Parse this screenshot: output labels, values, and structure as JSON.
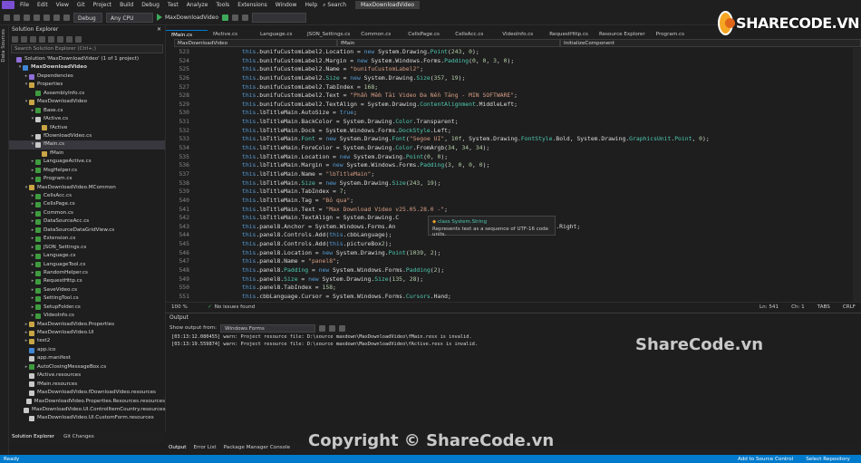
{
  "menubar": {
    "items": [
      "File",
      "Edit",
      "View",
      "Git",
      "Project",
      "Build",
      "Debug",
      "Test",
      "Analyze",
      "Tools",
      "Extensions",
      "Window",
      "Help"
    ],
    "search": "Search",
    "window_title": "MaxDownloadVideo"
  },
  "toolbar": {
    "config": "Debug",
    "platform": "Any CPU",
    "run_target": "MaxDownloadVideo"
  },
  "left_strip": {
    "label": "Data Sources"
  },
  "solution_explorer": {
    "title": "Solution Explorer",
    "search_placeholder": "Search Solution Explorer (Ctrl+;)",
    "items": [
      {
        "label": "Solution 'MaxDownloadVideo' (1 of 1 project)",
        "indent": 0,
        "toggle": "",
        "color": "#8f6fd8"
      },
      {
        "label": "MaxDownloadVideo",
        "indent": 1,
        "toggle": "▾",
        "color": "#3f86d6",
        "bold": true
      },
      {
        "label": "Dependencies",
        "indent": 2,
        "toggle": "▸",
        "color": "#8f6fd8"
      },
      {
        "label": "Properties",
        "indent": 2,
        "toggle": "▾",
        "color": "#c9a545"
      },
      {
        "label": "AssemblyInfo.cs",
        "indent": 3,
        "toggle": "",
        "color": "#3f9b3f"
      },
      {
        "label": "MaxDownloadVideo",
        "indent": 2,
        "toggle": "▾",
        "color": "#c9a545"
      },
      {
        "label": "Base.cs",
        "indent": 3,
        "toggle": "▸",
        "color": "#3f9b3f"
      },
      {
        "label": "fActive.cs",
        "indent": 3,
        "toggle": "▾",
        "color": "#c9c9c9"
      },
      {
        "label": "fActive",
        "indent": 4,
        "toggle": "",
        "color": "#c9a545"
      },
      {
        "label": "fDownloadVideo.cs",
        "indent": 3,
        "toggle": "▸",
        "color": "#c9c9c9"
      },
      {
        "label": "fMain.cs",
        "indent": 3,
        "toggle": "▾",
        "color": "#c9c9c9",
        "selected": true
      },
      {
        "label": "fMain",
        "indent": 4,
        "toggle": "",
        "color": "#c9a545"
      },
      {
        "label": "LanguageActive.cs",
        "indent": 3,
        "toggle": "▸",
        "color": "#3f9b3f"
      },
      {
        "label": "MsgHelper.cs",
        "indent": 3,
        "toggle": "▸",
        "color": "#3f9b3f"
      },
      {
        "label": "Program.cs",
        "indent": 3,
        "toggle": "▸",
        "color": "#3f9b3f"
      },
      {
        "label": "MaxDownloadVideo.MCommon",
        "indent": 2,
        "toggle": "▾",
        "color": "#c9a545"
      },
      {
        "label": "CellsAcc.cs",
        "indent": 3,
        "toggle": "▸",
        "color": "#3f9b3f"
      },
      {
        "label": "CellsPage.cs",
        "indent": 3,
        "toggle": "▸",
        "color": "#3f9b3f"
      },
      {
        "label": "Common.cs",
        "indent": 3,
        "toggle": "▸",
        "color": "#3f9b3f"
      },
      {
        "label": "DataSourceAcc.cs",
        "indent": 3,
        "toggle": "▸",
        "color": "#3f9b3f"
      },
      {
        "label": "DataSourceDataGridView.cs",
        "indent": 3,
        "toggle": "▸",
        "color": "#3f9b3f"
      },
      {
        "label": "Extension.cs",
        "indent": 3,
        "toggle": "▸",
        "color": "#3f9b3f"
      },
      {
        "label": "JSON_Settings.cs",
        "indent": 3,
        "toggle": "▸",
        "color": "#3f9b3f"
      },
      {
        "label": "Language.cs",
        "indent": 3,
        "toggle": "▸",
        "color": "#3f9b3f"
      },
      {
        "label": "LanguageTool.cs",
        "indent": 3,
        "toggle": "▸",
        "color": "#3f9b3f"
      },
      {
        "label": "RandomHelper.cs",
        "indent": 3,
        "toggle": "▸",
        "color": "#3f9b3f"
      },
      {
        "label": "RequestHttp.cs",
        "indent": 3,
        "toggle": "▸",
        "color": "#3f9b3f"
      },
      {
        "label": "SaveVideo.cs",
        "indent": 3,
        "toggle": "▸",
        "color": "#3f9b3f"
      },
      {
        "label": "SettingTool.cs",
        "indent": 3,
        "toggle": "▸",
        "color": "#3f9b3f"
      },
      {
        "label": "SetupFolder.cs",
        "indent": 3,
        "toggle": "▸",
        "color": "#3f9b3f"
      },
      {
        "label": "VideoInfo.cs",
        "indent": 3,
        "toggle": "▸",
        "color": "#3f9b3f"
      },
      {
        "label": "MaxDownloadVideo.Properties",
        "indent": 2,
        "toggle": "▸",
        "color": "#c9a545"
      },
      {
        "label": "MaxDownloadVideo.UI",
        "indent": 2,
        "toggle": "▸",
        "color": "#c9a545"
      },
      {
        "label": "test2",
        "indent": 2,
        "toggle": "▸",
        "color": "#c9a545"
      },
      {
        "label": "app.ico",
        "indent": 2,
        "toggle": "",
        "color": "#3f86d6"
      },
      {
        "label": "app.manifest",
        "indent": 2,
        "toggle": "",
        "color": "#c9c9c9"
      },
      {
        "label": "AutoClosingMessageBox.cs",
        "indent": 2,
        "toggle": "▸",
        "color": "#3f9b3f"
      },
      {
        "label": "fActive.resources",
        "indent": 2,
        "toggle": "",
        "color": "#c9c9c9"
      },
      {
        "label": "fMain.resources",
        "indent": 2,
        "toggle": "",
        "color": "#c9c9c9"
      },
      {
        "label": "MaxDownloadVideo.fDownloadVideo.resources",
        "indent": 2,
        "toggle": "",
        "color": "#c9c9c9"
      },
      {
        "label": "MaxDownloadVideo.Properties.Resources.resources",
        "indent": 2,
        "toggle": "",
        "color": "#c9c9c9"
      },
      {
        "label": "MaxDownloadVideo.UI.ControlItemCountry.resources",
        "indent": 2,
        "toggle": "",
        "color": "#c9c9c9"
      },
      {
        "label": "MaxDownloadVideo.UI.CustomForm.resources",
        "indent": 2,
        "toggle": "",
        "color": "#c9c9c9"
      }
    ],
    "tabs": [
      "Solution Explorer",
      "Git Changes"
    ]
  },
  "doc_tabs": [
    "fMain.cs",
    "fActive.cs",
    "Language.cs",
    "JSON_Settings.cs",
    "Common.cs",
    "CellsPage.cs",
    "CellsAcc.cs",
    "VideoInfo.cs",
    "RequestHttp.cs",
    "Resource Explorer",
    "Program.cs"
  ],
  "navbar": {
    "project": "MaxDownloadVideo",
    "class": "fMain",
    "member": "InitializeComponent"
  },
  "code": [
    {
      "n": "523",
      "t": "this.bunifuCustomLabel2.Location = new System.Drawing.Point(243, 0);"
    },
    {
      "n": "524",
      "t": "this.bunifuCustomLabel2.Margin = new System.Windows.Forms.Padding(0, 0, 3, 0);"
    },
    {
      "n": "525",
      "t": "this.bunifuCustomLabel2.Name = \"bunifuCustomLabel2\";"
    },
    {
      "n": "526",
      "t": "this.bunifuCustomLabel2.Size = new System.Drawing.Size(357, 19);"
    },
    {
      "n": "527",
      "t": "this.bunifuCustomLabel2.TabIndex = 168;"
    },
    {
      "n": "528",
      "t": "this.bunifuCustomLabel2.Text = \"Phần Mềm Tải Video Đa Nền Tảng - MIN SOFTWARE\";"
    },
    {
      "n": "529",
      "t": "this.bunifuCustomLabel2.TextAlign = System.Drawing.ContentAlignment.MiddleLeft;"
    },
    {
      "n": "530",
      "t": "this.lbTitleMain.AutoSize = true;"
    },
    {
      "n": "531",
      "t": "this.lbTitleMain.BackColor = System.Drawing.Color.Transparent;"
    },
    {
      "n": "532",
      "t": "this.lbTitleMain.Dock = System.Windows.Forms.DockStyle.Left;"
    },
    {
      "n": "533",
      "t": "this.lbTitleMain.Font = new System.Drawing.Font(\"Segoe UI\", 10f, System.Drawing.FontStyle.Bold, System.Drawing.GraphicsUnit.Point, 0);"
    },
    {
      "n": "534",
      "t": "this.lbTitleMain.ForeColor = System.Drawing.Color.FromArgb(34, 34, 34);"
    },
    {
      "n": "535",
      "t": "this.lbTitleMain.Location = new System.Drawing.Point(0, 0);"
    },
    {
      "n": "536",
      "t": "this.lbTitleMain.Margin = new System.Windows.Forms.Padding(3, 0, 0, 0);"
    },
    {
      "n": "537",
      "t": "this.lbTitleMain.Name = \"lbTitleMain\";"
    },
    {
      "n": "538",
      "t": "this.lbTitleMain.Size = new System.Drawing.Size(243, 19);"
    },
    {
      "n": "539",
      "t": "this.lbTitleMain.TabIndex = 7;"
    },
    {
      "n": "540",
      "t": "this.lbTitleMain.Tag = \"Bỏ qua\";"
    },
    {
      "n": "541",
      "t": "this.lbTitleMain.Text = \"Max Download Video v25.05.28.0 -\";"
    },
    {
      "n": "542",
      "t": "this.lbTitleMain.TextAlign = System.Drawing.C"
    },
    {
      "n": "543",
      "t": "this.panel8.Anchor = System.Windows.Forms.An                                   nchorStyles.Right;"
    },
    {
      "n": "544",
      "t": "this.panel8.Controls.Add(this.cbbLanguage);"
    },
    {
      "n": "545",
      "t": "this.panel8.Controls.Add(this.pictureBox2);"
    },
    {
      "n": "546",
      "t": "this.panel8.Location = new System.Drawing.Point(1039, 2);"
    },
    {
      "n": "547",
      "t": "this.panel8.Name = \"panel8\";"
    },
    {
      "n": "548",
      "t": "this.panel8.Padding = new System.Windows.Forms.Padding(2);"
    },
    {
      "n": "549",
      "t": "this.panel8.Size = new System.Drawing.Size(135, 28);"
    },
    {
      "n": "550",
      "t": "this.panel8.TabIndex = 158;"
    },
    {
      "n": "551",
      "t": "this.cbbLanguage.Cursor = System.Windows.Forms.Cursors.Hand;"
    }
  ],
  "tooltip": {
    "line1": "class System.String",
    "line2": "Represents text as a sequence of UTF-16 code units."
  },
  "editor_status": {
    "zoom": "100 %",
    "issues": "No issues found",
    "ln": "Ln: 541",
    "ch": "Ch: 1",
    "tabs": "TABS",
    "eol": "CRLF"
  },
  "output": {
    "title": "Output",
    "from_label": "Show output from:",
    "from_value": "Windows Forms",
    "lines": [
      "[03:13:12.080455] warn: Project resource file: D:\\source maxdown\\MaxDownloadVideo\\fMain.resx is invalid.",
      "[03:13:19.559874] warn: Project resource file: D:\\source maxdown\\MaxDownloadVideo\\fActive.resx is invalid."
    ]
  },
  "bottom_tabs": [
    "Output",
    "Error List",
    "Package Manager Console"
  ],
  "statusbar": {
    "ready": "Ready",
    "source_control": "Add to Source Control",
    "repository": "Select Repository"
  },
  "watermarks": {
    "logo": "SHARECODE.VN",
    "mid": "ShareCode.vn",
    "copyright": "Copyright © ShareCode.vn"
  }
}
